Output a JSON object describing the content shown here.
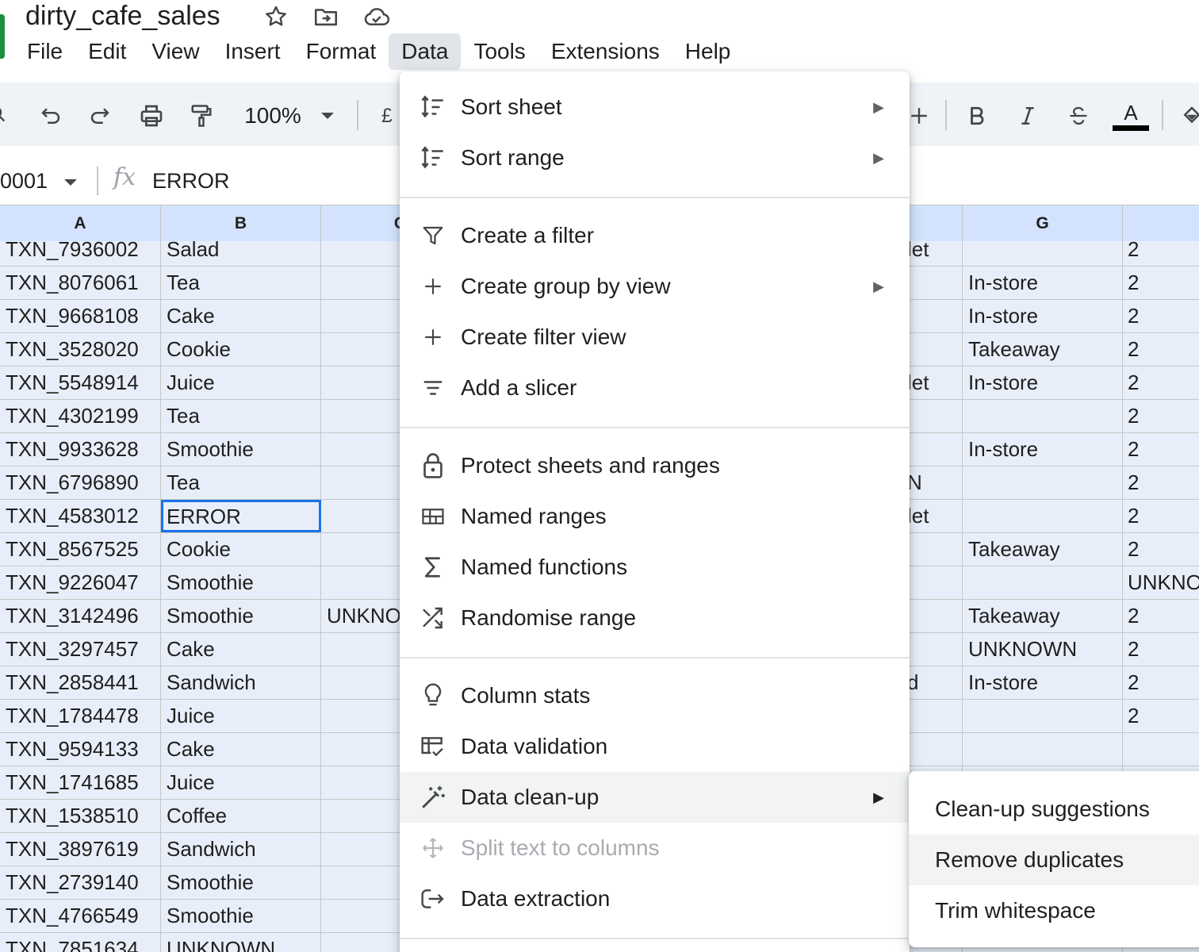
{
  "doc": {
    "title": "dirty_cafe_sales"
  },
  "menubar": [
    "File",
    "Edit",
    "View",
    "Insert",
    "Format",
    "Data",
    "Tools",
    "Extensions",
    "Help"
  ],
  "toolbar": {
    "zoom": "100%",
    "currency": "£",
    "font_color_letter": "A"
  },
  "formula_bar": {
    "cell_ref": "0001",
    "content": "ERROR"
  },
  "columns": {
    "a": "A",
    "b": "B",
    "c": "C",
    "g": "G"
  },
  "rows": [
    {
      "id": "TXN_7936002",
      "item": "Salad",
      "c": "",
      "f": "let",
      "g": "",
      "h": "2"
    },
    {
      "id": "TXN_8076061",
      "item": "Tea",
      "c": "",
      "f": "",
      "g": "In-store",
      "h": "2"
    },
    {
      "id": "TXN_9668108",
      "item": "Cake",
      "c": "",
      "f": "",
      "g": "In-store",
      "h": "2"
    },
    {
      "id": "TXN_3528020",
      "item": "Cookie",
      "c": "",
      "f": "",
      "g": "Takeaway",
      "h": "2"
    },
    {
      "id": "TXN_5548914",
      "item": "Juice",
      "c": "",
      "f": "let",
      "g": "In-store",
      "h": "2"
    },
    {
      "id": "TXN_4302199",
      "item": "Tea",
      "c": "",
      "f": "",
      "g": "",
      "h": "2"
    },
    {
      "id": "TXN_9933628",
      "item": "Smoothie",
      "c": "",
      "f": "",
      "g": "In-store",
      "h": "2"
    },
    {
      "id": "TXN_6796890",
      "item": "Tea",
      "c": "",
      "f": "N",
      "g": "",
      "h": "2"
    },
    {
      "id": "TXN_4583012",
      "item": "ERROR",
      "c": "",
      "f": "let",
      "g": "",
      "h": "2"
    },
    {
      "id": "TXN_8567525",
      "item": "Cookie",
      "c": "",
      "f": "",
      "g": "Takeaway",
      "h": "2"
    },
    {
      "id": "TXN_9226047",
      "item": "Smoothie",
      "c": "",
      "f": "",
      "g": "",
      "h": "UNKNO"
    },
    {
      "id": "TXN_3142496",
      "item": "Smoothie",
      "c": "UNKNO",
      "f": "",
      "g": "Takeaway",
      "h": "2"
    },
    {
      "id": "TXN_3297457",
      "item": "Cake",
      "c": "",
      "f": "",
      "g": "UNKNOWN",
      "h": "2"
    },
    {
      "id": "TXN_2858441",
      "item": "Sandwich",
      "c": "",
      "f": "d",
      "g": "In-store",
      "h": "2"
    },
    {
      "id": "TXN_1784478",
      "item": "Juice",
      "c": "",
      "f": "",
      "g": "",
      "h": "2"
    },
    {
      "id": "TXN_9594133",
      "item": "Cake",
      "c": "",
      "f": "",
      "g": "",
      "h": ""
    },
    {
      "id": "TXN_1741685",
      "item": "Juice",
      "c": "",
      "f": "",
      "g": "",
      "h": ""
    },
    {
      "id": "TXN_1538510",
      "item": "Coffee",
      "c": "",
      "f": "",
      "g": "",
      "h": ""
    },
    {
      "id": "TXN_3897619",
      "item": "Sandwich",
      "c": "",
      "f": "",
      "g": "",
      "h": ""
    },
    {
      "id": "TXN_2739140",
      "item": "Smoothie",
      "c": "",
      "f": "",
      "g": "",
      "h": ""
    },
    {
      "id": "TXN_4766549",
      "item": "Smoothie",
      "c": "",
      "f": "",
      "g": "",
      "h": ""
    },
    {
      "id": "TXN_7851634",
      "item": "UNKNOWN",
      "c": "",
      "f": "",
      "g": "",
      "h": ""
    }
  ],
  "data_menu": {
    "items": [
      {
        "label": "Sort sheet",
        "icon": "sort-icon",
        "submenu": true
      },
      {
        "label": "Sort range",
        "icon": "sort-icon",
        "submenu": true
      },
      {
        "label": "Create a filter",
        "icon": "filter-icon",
        "submenu": false
      },
      {
        "label": "Create group by view",
        "icon": "plus-icon",
        "submenu": true
      },
      {
        "label": "Create filter view",
        "icon": "plus-icon",
        "submenu": false
      },
      {
        "label": "Add a slicer",
        "icon": "slicer-icon",
        "submenu": false
      },
      {
        "label": "Protect sheets and ranges",
        "icon": "lock-icon",
        "submenu": false
      },
      {
        "label": "Named ranges",
        "icon": "named-ranges-icon",
        "submenu": false
      },
      {
        "label": "Named functions",
        "icon": "sigma-icon",
        "submenu": false
      },
      {
        "label": "Randomise range",
        "icon": "shuffle-icon",
        "submenu": false
      },
      {
        "label": "Column stats",
        "icon": "lightbulb-icon",
        "submenu": false
      },
      {
        "label": "Data validation",
        "icon": "data-validation-icon",
        "submenu": false
      },
      {
        "label": "Data clean-up",
        "icon": "magic-wand-icon",
        "submenu": true
      },
      {
        "label": "Split text to columns",
        "icon": "split-icon",
        "submenu": false
      },
      {
        "label": "Data extraction",
        "icon": "extraction-icon",
        "submenu": false
      }
    ]
  },
  "cleanup_submenu": {
    "items": [
      "Clean-up suggestions",
      "Remove duplicates",
      "Trim whitespace"
    ]
  }
}
